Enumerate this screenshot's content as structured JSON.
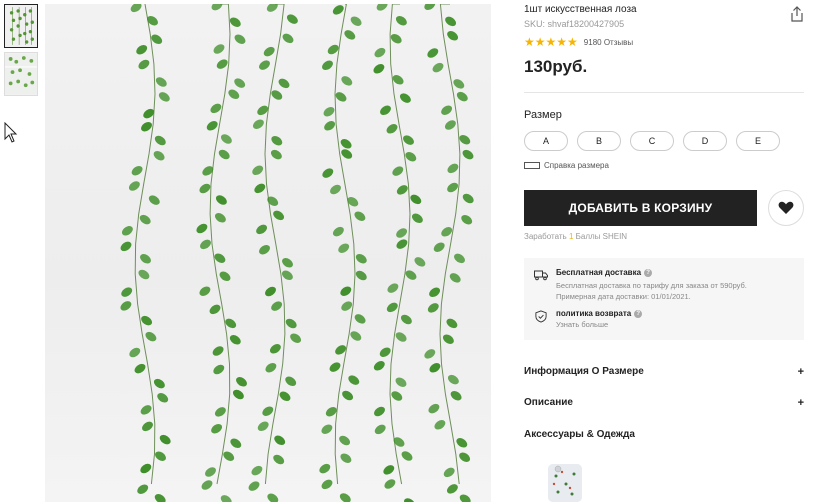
{
  "product": {
    "title": "1шт искусственная лоза",
    "sku": "SKU: shvaf18200427905",
    "stars": "★★★★★",
    "reviews": "9180 Отзывы",
    "price": "130руб."
  },
  "size": {
    "title": "Размер",
    "options": [
      "A",
      "B",
      "C",
      "D",
      "E"
    ],
    "guide": "Справка размера"
  },
  "actions": {
    "add_to_cart": "ДОБАВИТЬ В КОРЗИНУ",
    "points_prefix": "Заработать ",
    "points_num": "1",
    "points_suffix": " Баллы SHEIN"
  },
  "shipping": {
    "free_title": "Бесплатная доставка",
    "free_line1": "Бесплатная доставка по тарифу для заказа от 590руб.",
    "free_line2": "Примерная дата доставки: 01/01/2021.",
    "return_title": "политика возврата",
    "return_link": "Узнать больше"
  },
  "accordion": {
    "size_info": "Информация О Размере",
    "description": "Описание",
    "plus": "+"
  },
  "related": {
    "title": "Аксессуары & Одежда"
  },
  "icons": [
    "share-icon",
    "heart-icon",
    "truck-icon",
    "shield-icon",
    "ruler-icon",
    "cursor-icon",
    "question-icon"
  ],
  "colors": {
    "accent_star": "#f7b500",
    "button": "#222222",
    "leaf": "#3f8f2a"
  }
}
